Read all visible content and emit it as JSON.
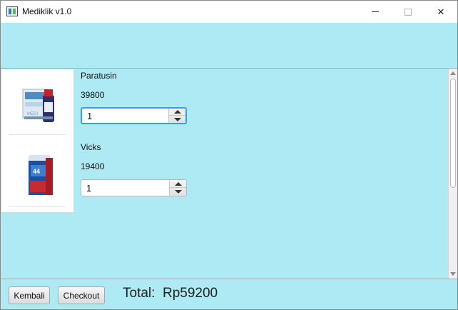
{
  "window": {
    "title": "Mediklik v1.0",
    "minimize_symbol": "",
    "close_symbol": "✕"
  },
  "products": [
    {
      "name": "Paratusin",
      "price": "39800",
      "quantity": "1",
      "image_icon": "medicine-bottle-icon"
    },
    {
      "name": "Vicks",
      "price": "19400",
      "quantity": "1",
      "image_icon": "medicine-box-icon"
    }
  ],
  "footer": {
    "back_label": "Kembali",
    "checkout_label": "Checkout",
    "total_label": "Total:",
    "total_value": "Rp59200"
  },
  "colors": {
    "background": "#aeeaf3",
    "focus_ring": "#3c9fe0"
  }
}
